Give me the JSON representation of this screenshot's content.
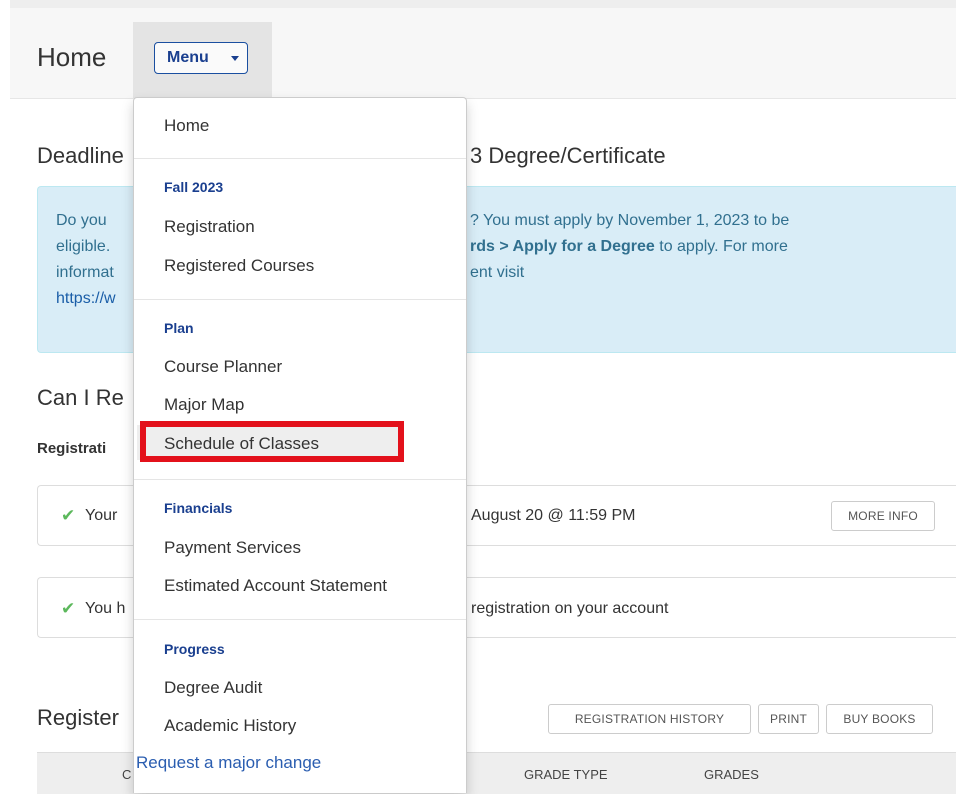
{
  "header": {
    "title": "Home",
    "menu_button": "Menu"
  },
  "deadline": {
    "heading_left": "Deadline",
    "heading_right": "3 Degree/Certificate",
    "line1_left": "Do you",
    "line1_right": "? You must apply by November 1, 2023 to be",
    "line2_left": "eligible.",
    "line2_bold": "rds > Apply for a Degree",
    "line2_right": " to apply. For more",
    "line3_left": "informat",
    "line3_right": "ent visit",
    "line4_link": "https://w"
  },
  "can_register": {
    "heading": "Can I Re",
    "status_label": "Registrati",
    "panel1_left": "Your",
    "panel1_right": "August 20 @ 11:59 PM",
    "more_info": "MORE INFO",
    "panel2_left": "You h",
    "panel2_right": "registration on your account",
    "check_icon": "✔"
  },
  "registered": {
    "heading": "Register",
    "buttons": {
      "history": "REGISTRATION HISTORY",
      "print": "PRINT",
      "buy_books": "BUY BOOKS"
    },
    "columns": {
      "c1": "C",
      "grade_type": "GRADE TYPE",
      "grades": "GRADES"
    }
  },
  "dropdown": {
    "home": "Home",
    "sections": [
      {
        "header": "Fall 2023",
        "items": [
          "Registration",
          "Registered Courses"
        ]
      },
      {
        "header": "Plan",
        "items": [
          "Course Planner",
          "Major Map",
          "Schedule of Classes"
        ]
      },
      {
        "header": "Financials",
        "items": [
          "Payment Services",
          "Estimated Account Statement"
        ]
      },
      {
        "header": "Progress",
        "items": [
          "Degree Audit",
          "Academic History"
        ]
      }
    ],
    "request_link": "Request a major change"
  },
  "colors": {
    "accent": "#1a3f8f",
    "highlight": "#e3111b",
    "alert_bg": "#d9edf7",
    "check": "#5cb85c"
  }
}
